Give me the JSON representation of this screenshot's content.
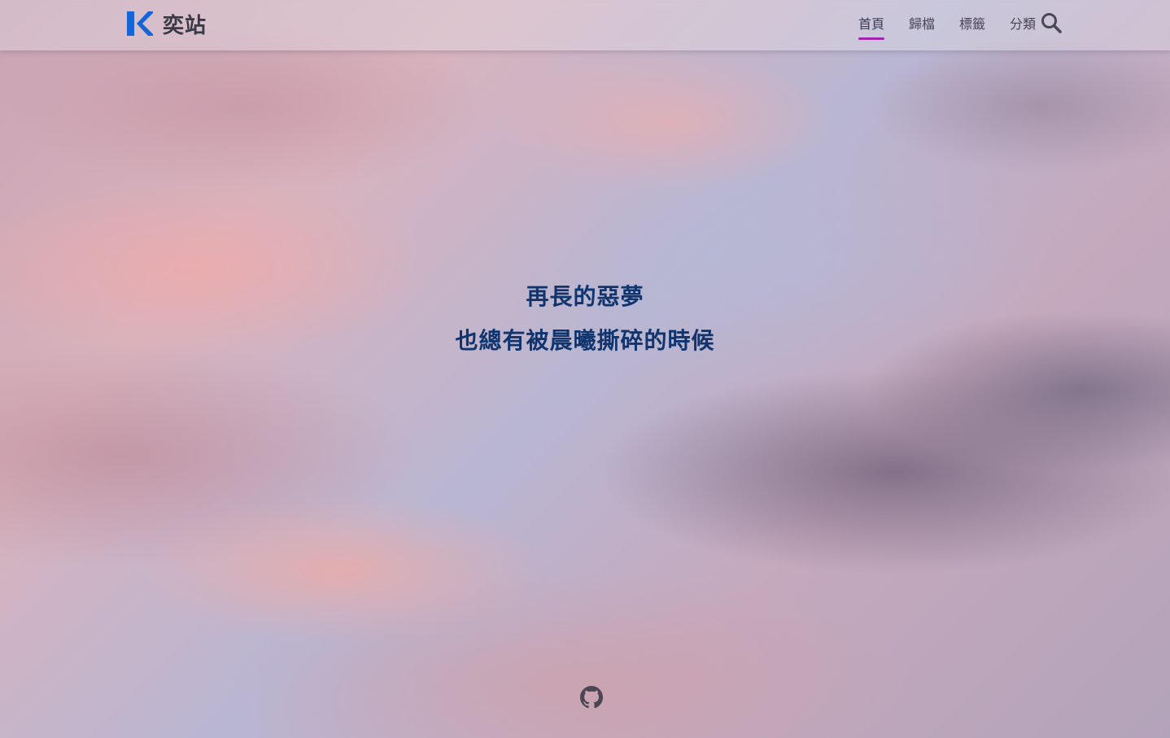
{
  "header": {
    "brand_name": "奕站",
    "nav": [
      {
        "label": "首頁",
        "active": true
      },
      {
        "label": "歸檔",
        "active": false
      },
      {
        "label": "標籤",
        "active": false
      },
      {
        "label": "分類",
        "active": false
      }
    ],
    "search_icon": "search-icon"
  },
  "hero": {
    "line1": "再長的惡夢",
    "line2": "也總有被晨曦撕碎的時候"
  },
  "footer": {
    "social_icon": "github-icon"
  },
  "colors": {
    "brand_blue": "#1565d8",
    "nav_active_underline": "#a323b5",
    "hero_text": "#10356e"
  }
}
